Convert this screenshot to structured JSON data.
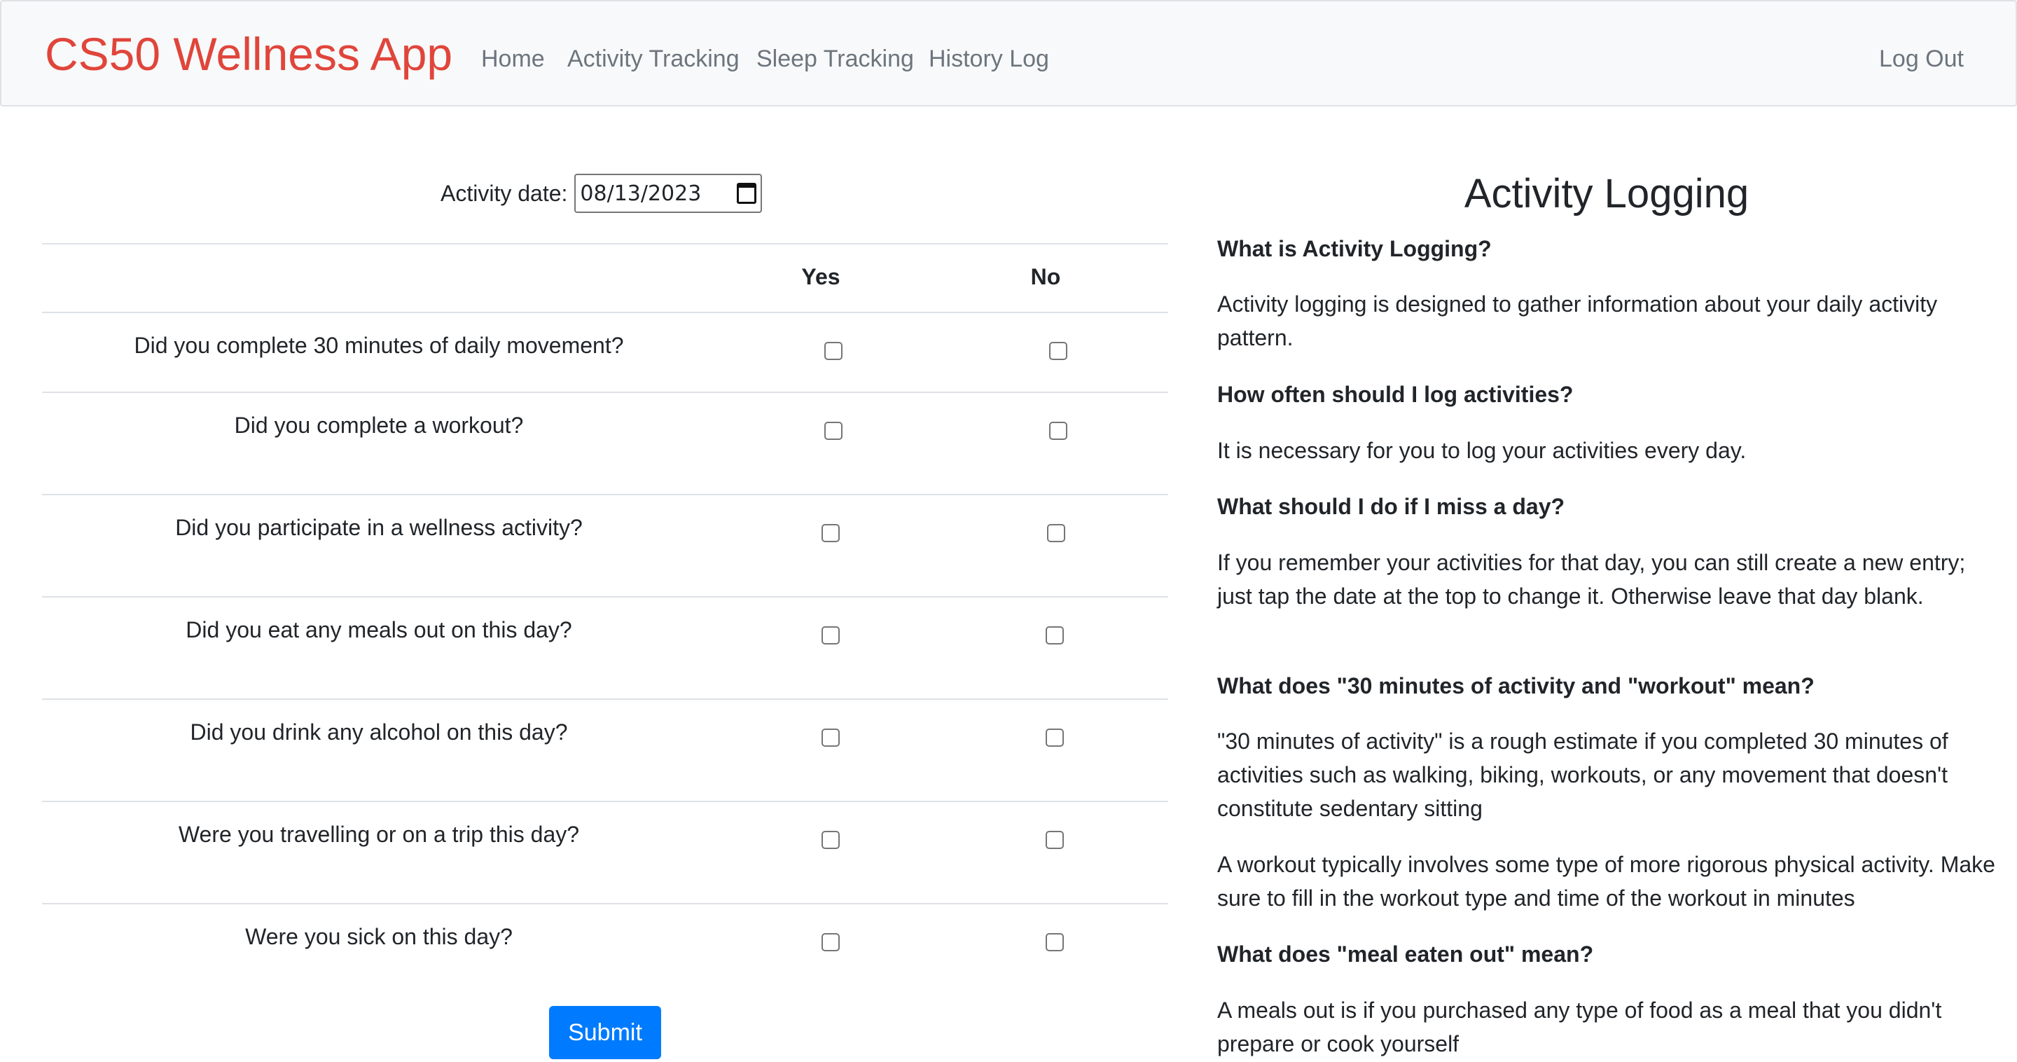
{
  "navbar": {
    "brand": "CS50 Wellness App",
    "links": [
      "Home",
      "Activity Tracking",
      "Sleep Tracking",
      "History Log"
    ],
    "logout": "Log Out"
  },
  "form": {
    "date_label": "Activity date:",
    "date_value": "08/13/2023",
    "col_yes": "Yes",
    "col_no": "No",
    "questions": [
      "Did you complete 30 minutes of daily movement?",
      "Did you complete a workout?",
      "Did you participate in a wellness activity?",
      "Did you eat any meals out on this day?",
      "Did you drink any alcohol on this day?",
      "Were you travelling or on a trip this day?",
      "Were you sick on this day?"
    ],
    "submit": "Submit"
  },
  "info": {
    "title": "Activity Logging",
    "q1": "What is Activity Logging?",
    "a1": "Activity logging is designed to gather information about your daily activity pattern.",
    "q2": "How often should I log activities?",
    "a2": "It is necessary for you to log your activities every day.",
    "q3": "What should I do if I miss a day?",
    "a3": "If you remember your activities for that day, you can still create a new entry; just tap the date at the top to change it. Otherwise leave that day blank.",
    "q4": "What does \"30 minutes of activity and \"workout\" mean?",
    "a4a": "\"30 minutes of activity\" is a rough estimate if you completed 30 minutes of activities such as walking, biking, workouts, or any movement that doesn't constitute sedentary sitting",
    "a4b": "A workout typically involves some type of more rigorous physical activity. Make sure to fill in the workout type and time of the workout in minutes",
    "q5": "What does \"meal eaten out\" mean?",
    "a5": "A meals out is if you purchased any type of food as a meal that you didn't prepare or cook yourself"
  },
  "colors": {
    "brand": "#e0453b",
    "primary": "#007bff",
    "navbar_bg": "#f8f9fa",
    "nav_link": "#6c757d"
  }
}
